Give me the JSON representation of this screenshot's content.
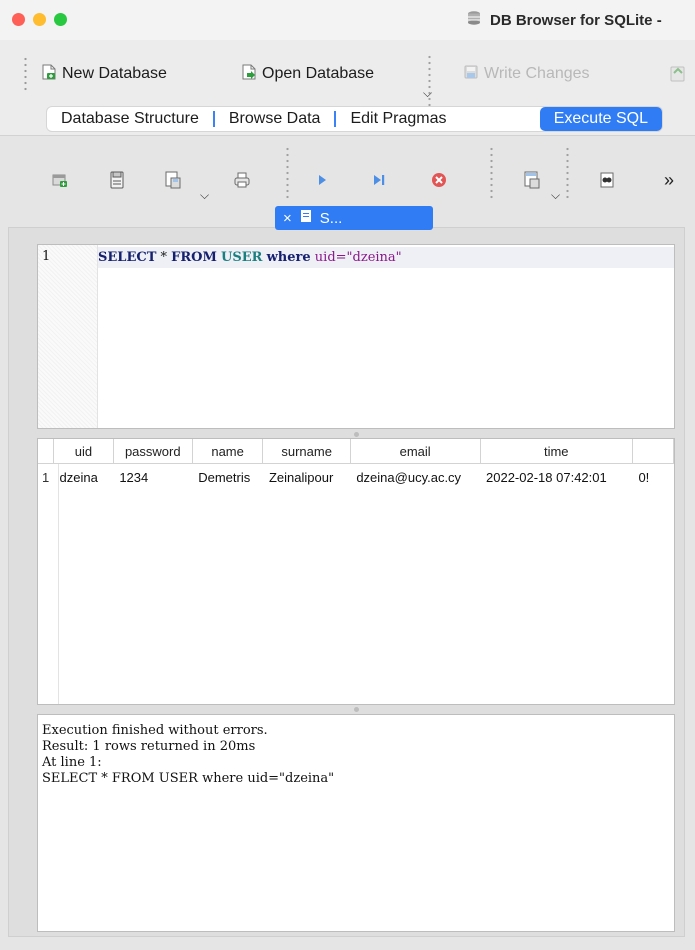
{
  "window": {
    "title": "DB Browser for SQLite -",
    "traffic_colors": {
      "close": "#fe5f57",
      "minimize": "#febc2e",
      "zoom": "#28c840"
    }
  },
  "main_toolbar": {
    "new_database": "New Database",
    "open_database": "Open Database",
    "write_changes": "Write Changes"
  },
  "tabs": [
    {
      "label": "Database Structure",
      "active": false
    },
    {
      "label": "Browse Data",
      "active": false
    },
    {
      "label": "Edit Pragmas",
      "active": false
    },
    {
      "label": "Execute SQL",
      "active": true
    }
  ],
  "sql_toolbar": {
    "icons": [
      "open-tab-icon",
      "open-sql-file-icon",
      "save-sql-file-icon",
      "print-icon",
      "execute-all-icon",
      "execute-current-line-icon",
      "stop-execution-icon",
      "save-results-icon",
      "find-icon",
      "more-icon"
    ],
    "overflow": "»"
  },
  "editor_tab": {
    "label": "S...",
    "close": "×"
  },
  "editor": {
    "line_number": "1",
    "tokens": [
      {
        "text": "SELECT",
        "type": "keyword"
      },
      {
        "text": " * ",
        "type": "plain"
      },
      {
        "text": "FROM",
        "type": "keyword"
      },
      {
        "text": " ",
        "type": "plain"
      },
      {
        "text": "USER",
        "type": "table"
      },
      {
        "text": " ",
        "type": "plain"
      },
      {
        "text": "where",
        "type": "keyword"
      },
      {
        "text": " ",
        "type": "plain"
      },
      {
        "text": "uid",
        "type": "identifier"
      },
      {
        "text": "=\"dzeina\"",
        "type": "identifier"
      }
    ]
  },
  "results": {
    "columns": [
      "uid",
      "password",
      "name",
      "surname",
      "email",
      "time",
      ""
    ],
    "rows": [
      {
        "num": "1",
        "cells": [
          "dzeina",
          "1234",
          "Demetris",
          "Zeinalipour",
          "dzeina@ucy.ac.cy",
          "2022-02-18 07:42:01",
          "0!"
        ]
      }
    ]
  },
  "messages": [
    "Execution finished without errors.",
    "Result: 1 rows returned in 20ms",
    "At line 1:",
    "SELECT * FROM USER where uid=\"dzeina\""
  ]
}
